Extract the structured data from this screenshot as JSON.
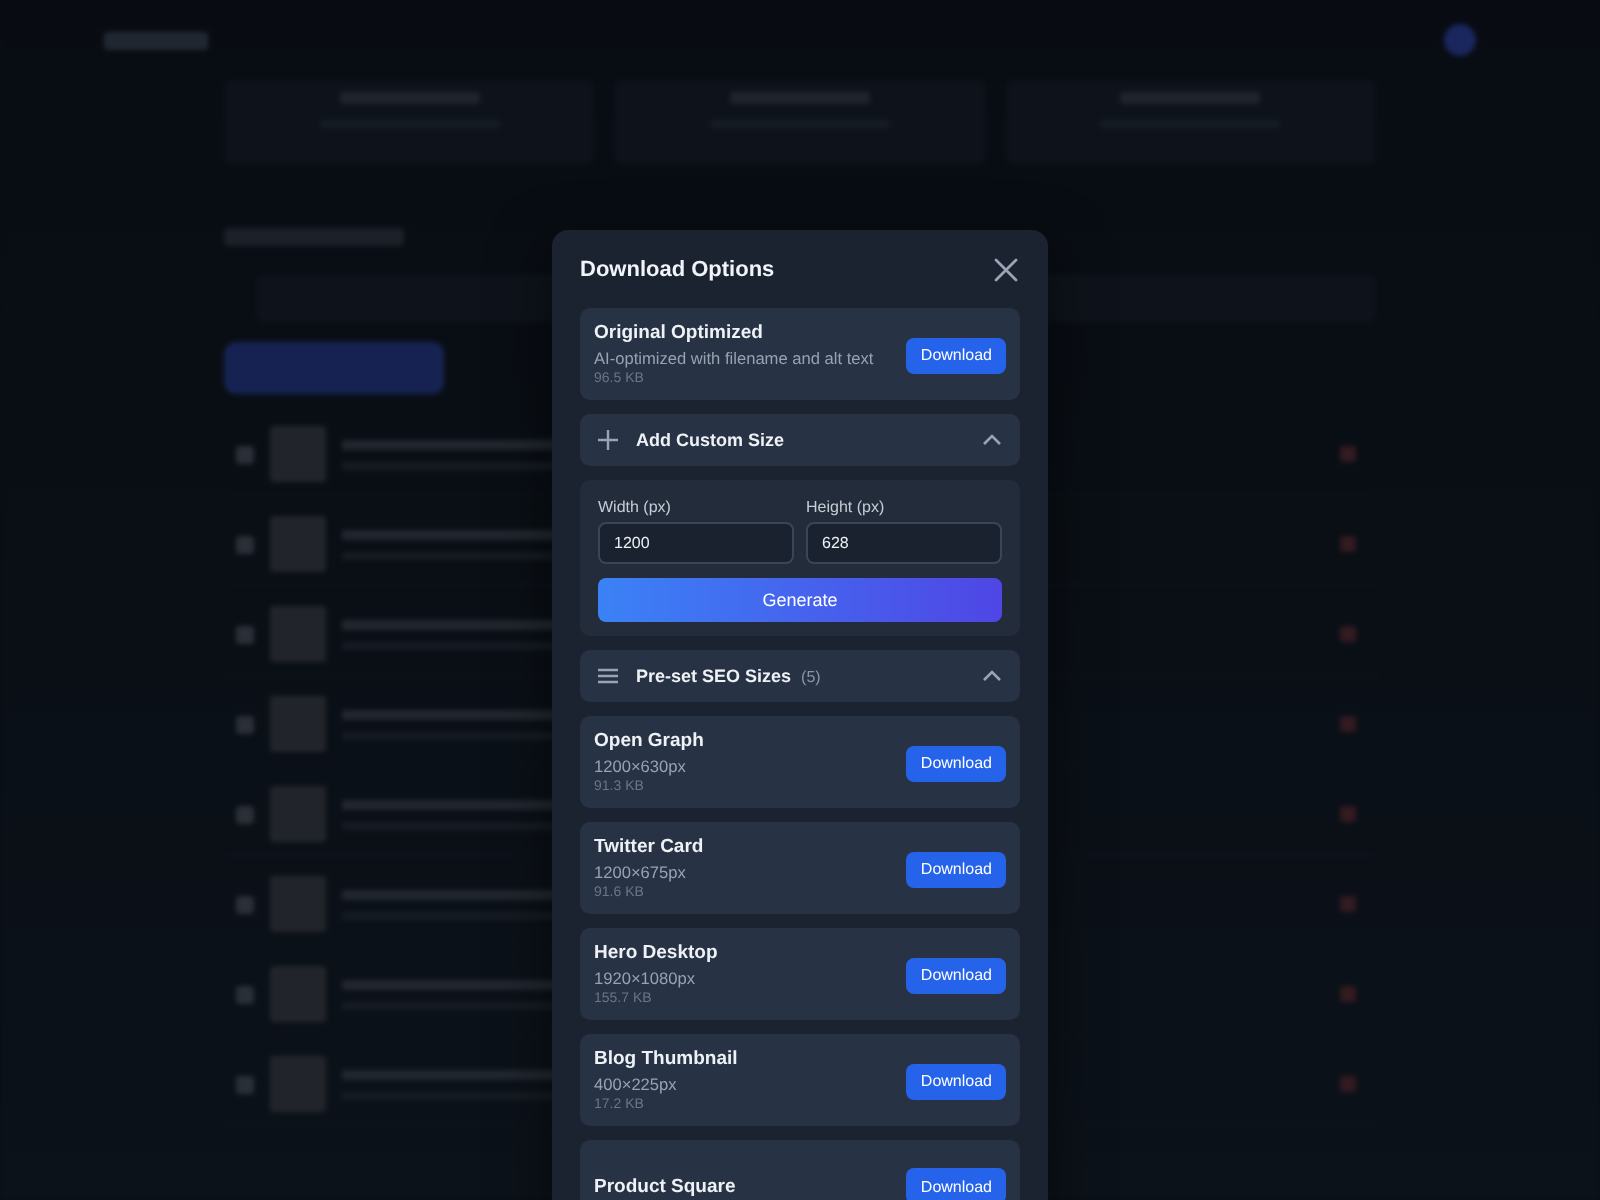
{
  "modal": {
    "title": "Download Options",
    "original": {
      "name": "Original Optimized",
      "description": "AI-optimized with filename and alt text",
      "size": "96.5 KB",
      "button": "Download"
    },
    "custom_size": {
      "label": "Add Custom Size",
      "expanded": true,
      "width_label": "Width (px)",
      "width_value": "1200",
      "height_label": "Height (px)",
      "height_value": "628",
      "button": "Generate"
    },
    "presets": {
      "label": "Pre-set SEO Sizes",
      "count": "(5)",
      "expanded": true,
      "items": [
        {
          "name": "Open Graph",
          "dimensions": "1200×630px",
          "size": "91.3 KB",
          "button": "Download"
        },
        {
          "name": "Twitter Card",
          "dimensions": "1200×675px",
          "size": "91.6 KB",
          "button": "Download"
        },
        {
          "name": "Hero Desktop",
          "dimensions": "1920×1080px",
          "size": "155.7 KB",
          "button": "Download"
        },
        {
          "name": "Blog Thumbnail",
          "dimensions": "400×225px",
          "size": "17.2 KB",
          "button": "Download"
        },
        {
          "name": "Product Square",
          "button": "Download"
        }
      ]
    }
  }
}
